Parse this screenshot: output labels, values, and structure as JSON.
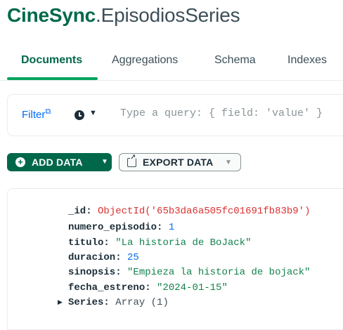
{
  "header": {
    "database": "CineSync",
    "separator": ".",
    "collection": "EpisodiosSeries"
  },
  "tabs": [
    {
      "label": "Documents",
      "active": true
    },
    {
      "label": "Aggregations",
      "active": false
    },
    {
      "label": "Schema",
      "active": false
    },
    {
      "label": "Indexes",
      "active": false
    }
  ],
  "query": {
    "filter_label": "Filter",
    "filter_link_icon": "external-link-icon",
    "history_icon": "clock-icon",
    "placeholder": "Type a query: { field: 'value' }"
  },
  "toolbar": {
    "add_data_label": "ADD DATA",
    "export_data_label": "EXPORT DATA"
  },
  "document": {
    "fields": [
      {
        "key": "_id",
        "value": "ObjectId('65b3da6a505fc01691fb83b9')",
        "type": "objectid"
      },
      {
        "key": "numero_episodio",
        "value": "1",
        "type": "number"
      },
      {
        "key": "titulo",
        "value": "\"La historia de BoJack\"",
        "type": "string"
      },
      {
        "key": "duracion",
        "value": "25",
        "type": "number"
      },
      {
        "key": "sinopsis",
        "value": "\"Empieza la historia de bojack\"",
        "type": "string"
      },
      {
        "key": "fecha_estreno",
        "value": "\"2024-01-15\"",
        "type": "string"
      },
      {
        "key": "Series",
        "value": "Array (1)",
        "type": "array",
        "expandable": true
      }
    ]
  },
  "colors": {
    "brand_green": "#00684a",
    "accent_green": "#00a35c",
    "link_blue": "#016bf8",
    "objectid_red": "#db3030",
    "string_green": "#12824d"
  }
}
